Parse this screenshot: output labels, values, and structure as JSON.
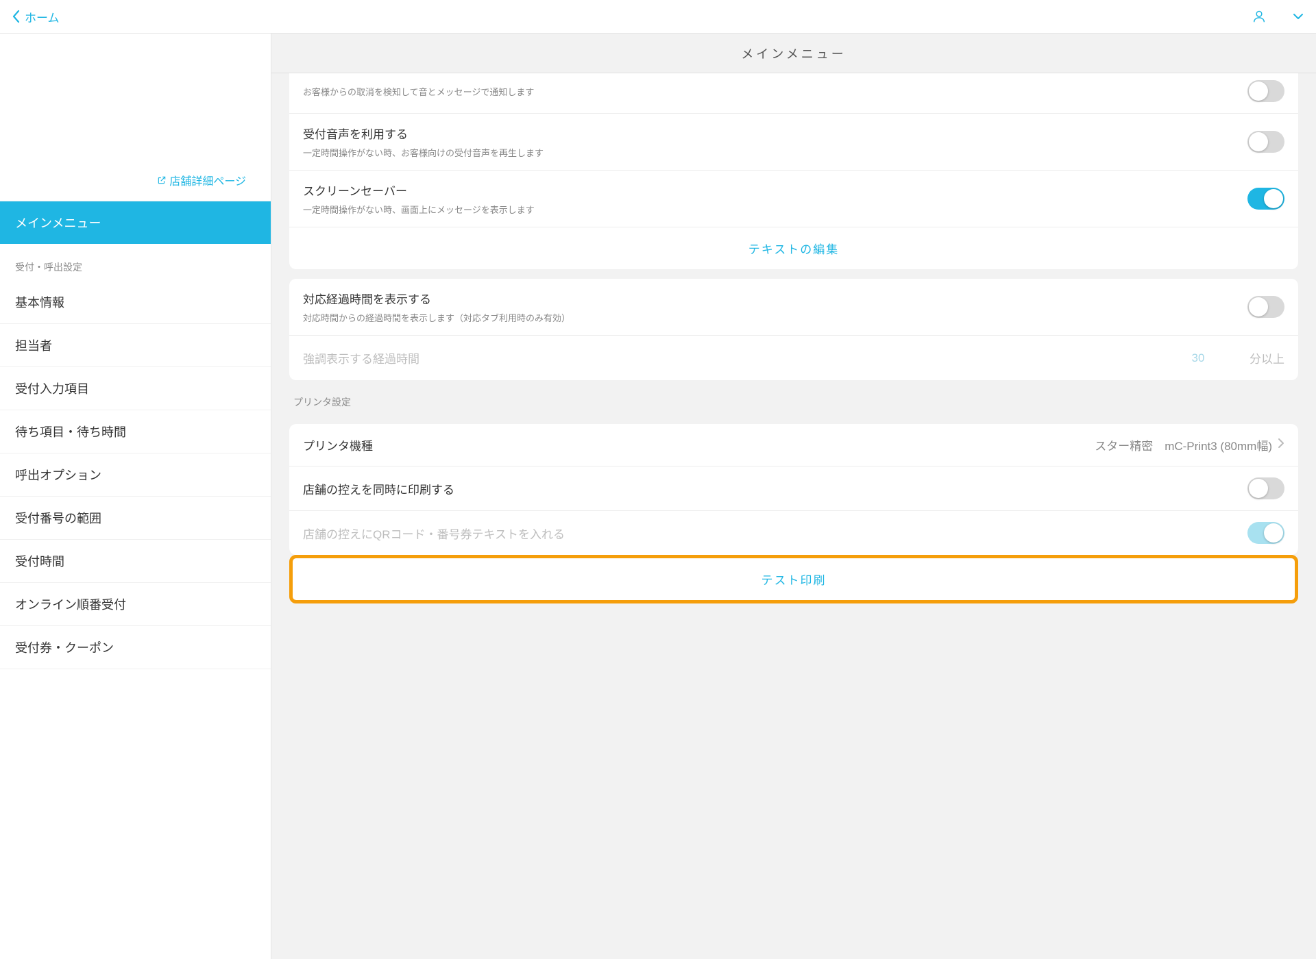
{
  "topbar": {
    "back_label": "ホーム"
  },
  "sidebar": {
    "detail_link": "店舗詳細ページ",
    "active_item": "メインメニュー",
    "section_title": "受付・呼出設定",
    "items": [
      "基本情報",
      "担当者",
      "受付入力項目",
      "待ち項目・待ち時間",
      "呼出オプション",
      "受付番号の範囲",
      "受付時間",
      "オンライン順番受付",
      "受付券・クーポン"
    ]
  },
  "main": {
    "header_title": "メインメニュー",
    "truncated_desc": "お客様からの取消を検知して音とメッセージで通知します",
    "settings": [
      {
        "title": "受付音声を利用する",
        "desc": "一定時間操作がない時、お客様向けの受付音声を再生します",
        "on": false
      },
      {
        "title": "スクリーンセーバー",
        "desc": "一定時間操作がない時、画面上にメッセージを表示します",
        "on": true
      }
    ],
    "edit_text_link": "テキストの編集",
    "elapsed": {
      "title": "対応経過時間を表示する",
      "desc": "対応時間からの経過時間を表示します（対応タブ利用時のみ有効）",
      "on": false,
      "input_label": "強調表示する経過時間",
      "input_value": "30",
      "input_suffix": "分以上"
    },
    "printer_section": "プリンタ設定",
    "printer": {
      "model_label": "プリンタ機種",
      "model_value": "スター精密　mC-Print3 (80mm幅)",
      "copy_title": "店舗の控えを同時に印刷する",
      "copy_on": false,
      "qr_title": "店舗の控えにQRコード・番号券テキストを入れる",
      "qr_on": true,
      "test_print": "テスト印刷"
    }
  }
}
